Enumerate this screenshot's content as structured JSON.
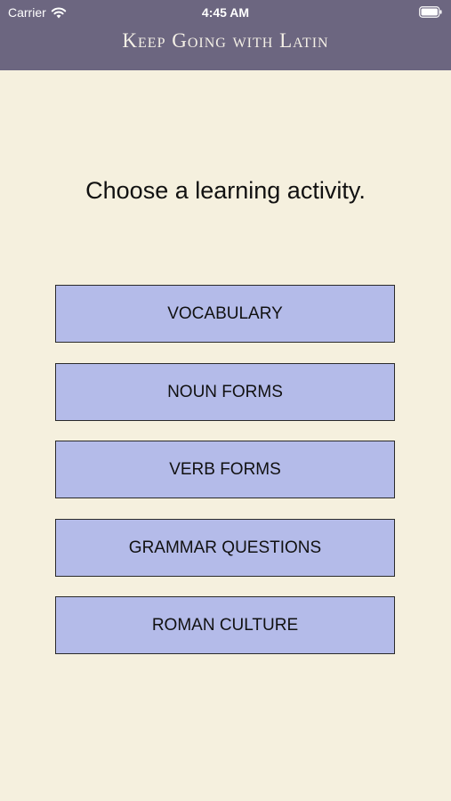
{
  "status_bar": {
    "carrier": "Carrier",
    "time": "4:45 AM",
    "wifi_icon": "wifi-icon",
    "battery_icon": "battery-icon"
  },
  "header": {
    "title": "Keep Going with Latin",
    "background_color": "#6c6680"
  },
  "main": {
    "prompt": "Choose a learning activity.",
    "background_color": "#f5f0de",
    "button_color": "#b4bbe9",
    "activities": [
      {
        "label": "VOCABULARY"
      },
      {
        "label": "NOUN FORMS"
      },
      {
        "label": "VERB FORMS"
      },
      {
        "label": "GRAMMAR QUESTIONS"
      },
      {
        "label": "ROMAN CULTURE"
      }
    ]
  }
}
